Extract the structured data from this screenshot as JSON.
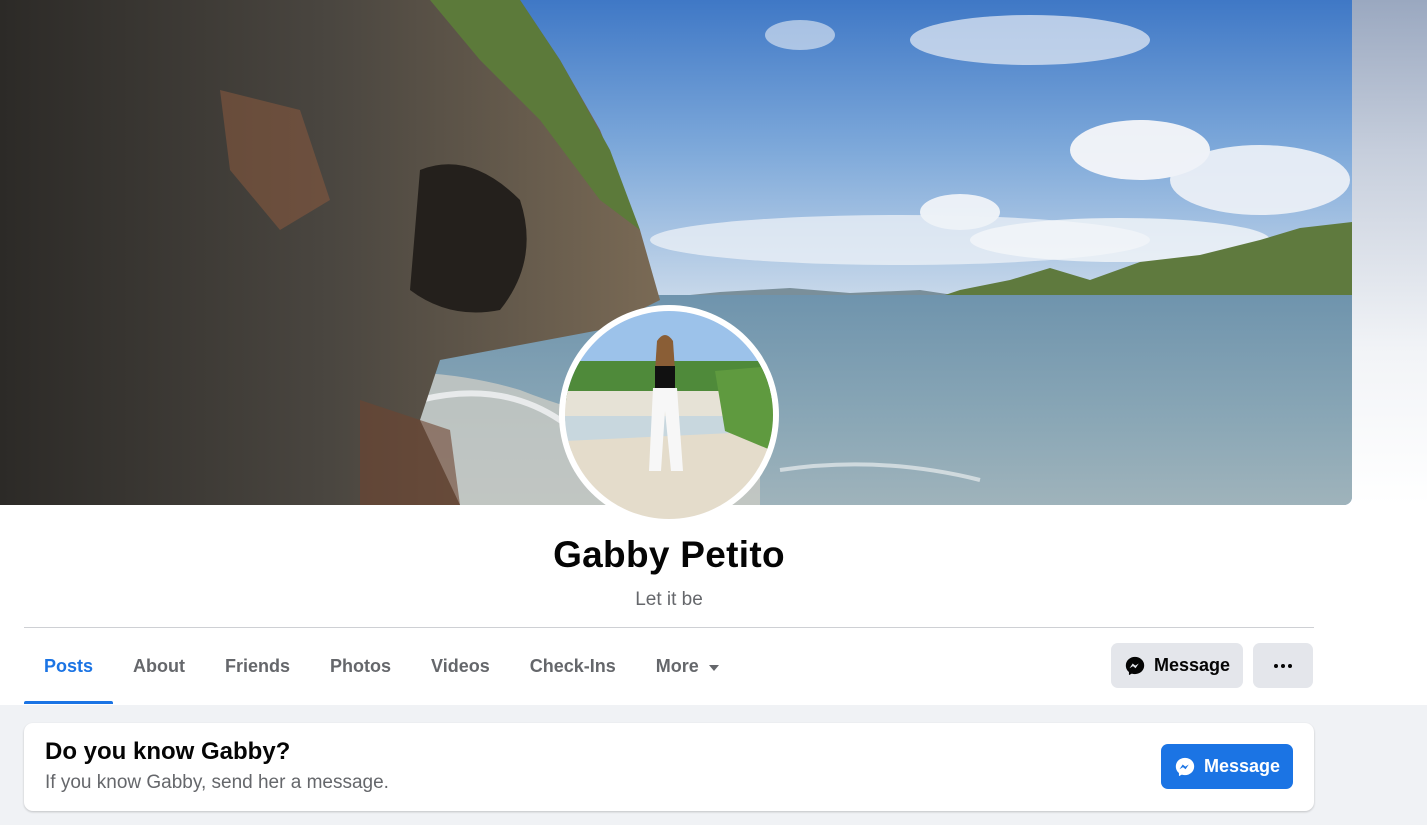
{
  "profile": {
    "name": "Gabby Petito",
    "bio": "Let it be"
  },
  "tabs": [
    {
      "label": "Posts",
      "active": true
    },
    {
      "label": "About"
    },
    {
      "label": "Friends"
    },
    {
      "label": "Photos"
    },
    {
      "label": "Videos"
    },
    {
      "label": "Check-Ins"
    },
    {
      "label": "More",
      "icon": "caret-down-icon"
    }
  ],
  "actions": {
    "message_label": "Message",
    "message_icon": "messenger-icon",
    "more_icon": "more-dots-icon"
  },
  "know_card": {
    "title": "Do you know Gabby?",
    "subtitle": "If you know Gabby, send her a message.",
    "button_label": "Message",
    "button_icon": "messenger-icon"
  },
  "colors": {
    "accent": "#1b74e4",
    "secondary_text": "#65676b",
    "button_grey": "#e4e6eb",
    "page_background": "#f0f2f5"
  }
}
